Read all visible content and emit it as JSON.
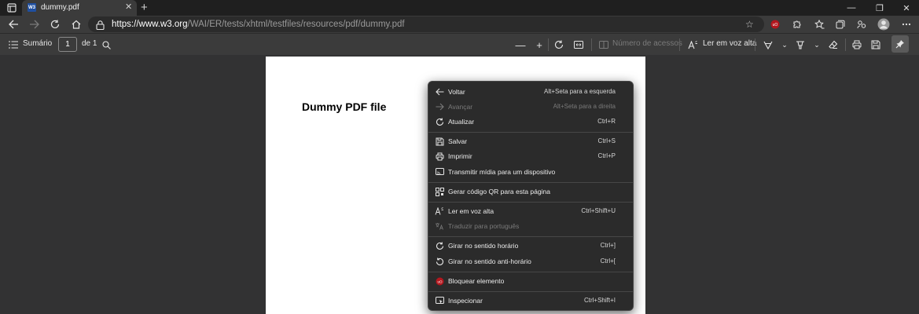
{
  "tab": {
    "favicon_text": "W3",
    "title": "dummy.pdf"
  },
  "address": {
    "host": "https://www.w3.org",
    "path": "/WAI/ER/tests/xhtml/testfiles/resources/pdf/dummy.pdf"
  },
  "pdf_toolbar": {
    "contents_label": "Sumário",
    "page_number": "1",
    "page_total": "de 1",
    "accessibility_placeholder": "Número de acessos",
    "read_aloud_label": "Ler em voz alta"
  },
  "document": {
    "title": "Dummy PDF file"
  },
  "context_menu": {
    "items": [
      {
        "label": "Voltar",
        "shortcut": "Alt+Seta para a esquerda",
        "enabled": true,
        "icon": "back-arrow-icon"
      },
      {
        "label": "Avançar",
        "shortcut": "Alt+Seta para a direita",
        "enabled": false,
        "icon": "forward-arrow-icon"
      },
      {
        "label": "Atualizar",
        "shortcut": "Ctrl+R",
        "enabled": true,
        "icon": "refresh-icon"
      },
      {
        "label": "Salvar",
        "shortcut": "Ctrl+S",
        "enabled": true,
        "icon": "save-icon"
      },
      {
        "label": "Imprimir",
        "shortcut": "Ctrl+P",
        "enabled": true,
        "icon": "print-icon"
      },
      {
        "label": "Transmitir mídia para um dispositivo",
        "shortcut": "",
        "enabled": true,
        "icon": "cast-icon"
      },
      {
        "label": "Gerar código QR para esta página",
        "shortcut": "",
        "enabled": true,
        "icon": "qr-code-icon"
      },
      {
        "label": "Ler em voz alta",
        "shortcut": "Ctrl+Shift+U",
        "enabled": true,
        "icon": "read-aloud-icon"
      },
      {
        "label": "Traduzir para português",
        "shortcut": "",
        "enabled": false,
        "icon": "translate-icon"
      },
      {
        "label": "Girar no sentido horário",
        "shortcut": "Ctrl+]",
        "enabled": true,
        "icon": "rotate-clockwise-icon"
      },
      {
        "label": "Girar no sentido anti-horário",
        "shortcut": "Ctrl+[",
        "enabled": true,
        "icon": "rotate-counterclockwise-icon"
      },
      {
        "label": "Bloquear elemento",
        "shortcut": "",
        "enabled": true,
        "icon": "ublock-icon"
      },
      {
        "label": "Inspecionar",
        "shortcut": "Ctrl+Shift+I",
        "enabled": true,
        "icon": "inspect-icon"
      }
    ]
  },
  "colors": {
    "menu_bg": "#2b2b2b",
    "toolbar_bg": "#3b3b3b",
    "ublock_red": "#b3171e"
  }
}
